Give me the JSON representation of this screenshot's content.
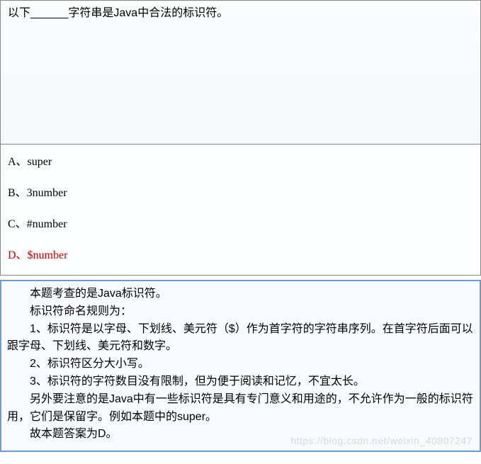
{
  "question": {
    "text": "以下______字符串是Java中合法的标识符。"
  },
  "options": {
    "a": "A、super",
    "b": "B、3number",
    "c": "C、#number",
    "d": "D、$number"
  },
  "explanation": {
    "line1": "本题考查的是Java标识符。",
    "line2": "标识符命名规则为：",
    "line3": "1、标识符是以字母、下划线、美元符（$）作为首字符的字符串序列。在首字符后面可以跟字母、下划线、美元符和数字。",
    "line4": "2、标识符区分大小写。",
    "line5": "3、标识符的字符数目没有限制，但为便于阅读和记忆，不宜太长。",
    "line6": "另外要注意的是Java中有一些标识符是具有专门意义和用途的，不允许作为一般的标识符用，它们是保留字。例如本题中的super。",
    "line7": "故本题答案为D。"
  },
  "watermark": "https://blog.csdn.net/weixin_40807247"
}
